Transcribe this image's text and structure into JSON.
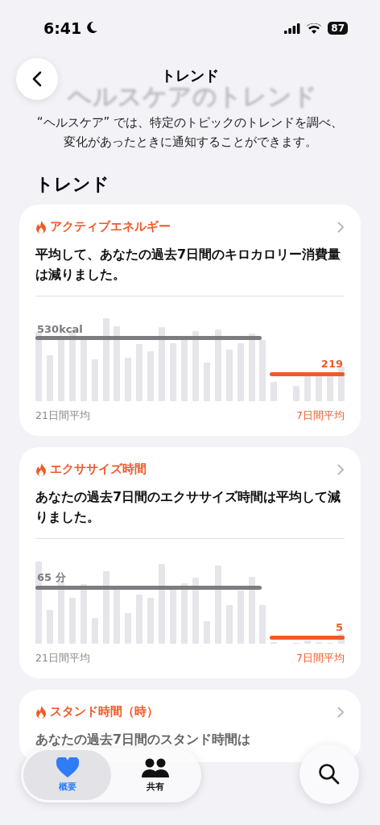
{
  "status_bar": {
    "time": "6:41",
    "battery": "87"
  },
  "nav": {
    "title": "トレンド",
    "large_title": "ヘルスケアのトレンド"
  },
  "description": "“ヘルスケア” では、特定のトピックのトレンドを調べ、変化があったときに通知することができます。",
  "section_title": "トレンド",
  "cards": [
    {
      "kind": "chart",
      "title": "アクティブエネルギー",
      "summary": "平均して、あなたの過去7日間のキロカロリー消費量は減りました。",
      "long_average": "530kcal",
      "short_average": "219",
      "long_label": "21日間平均",
      "short_label": "7日間平均"
    },
    {
      "kind": "chart",
      "title": "エクササイズ時間",
      "summary": "あなたの過去7日間のエクササイズ時間は平均して減りました。",
      "long_average": "65 分",
      "short_average": "5",
      "long_label": "21日間平均",
      "short_label": "7日間平均"
    },
    {
      "kind": "partial",
      "title": "スタンド時間（時）",
      "summary": "あなたの過去7日間のスタンド時間は"
    }
  ],
  "tab_bar": {
    "tabs": [
      {
        "label": "概要",
        "selected": true
      },
      {
        "label": "共有",
        "selected": false
      }
    ]
  }
}
